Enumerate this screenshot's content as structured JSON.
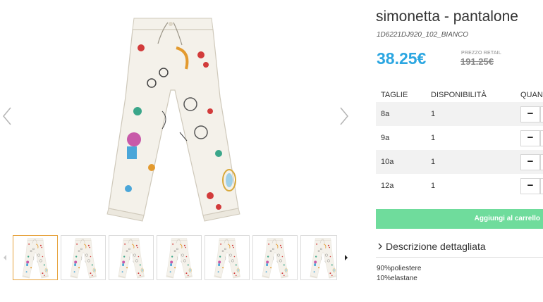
{
  "product": {
    "title": "simonetta - pantalone",
    "sku": "1D6221DJ920_102_BIANCO",
    "price": "38.25€",
    "retail_label": "PREZZO RETAIL",
    "retail_price": "191.25€"
  },
  "sizes_table": {
    "headers": [
      "TAGLIE",
      "DISPONIBILITÀ",
      "QUAN"
    ],
    "rows": [
      {
        "size": "8a",
        "availability": "1",
        "minus": "−"
      },
      {
        "size": "9a",
        "availability": "1",
        "minus": "−"
      },
      {
        "size": "10a",
        "availability": "1",
        "minus": "−"
      },
      {
        "size": "12a",
        "availability": "1",
        "minus": "−"
      }
    ]
  },
  "cart_button": "Aggiungi al carrello",
  "description": {
    "heading": "Descrizione dettagliata",
    "lines": [
      "90%poliestere",
      "10%elastane"
    ]
  },
  "colors": {
    "price": "#2ba6e1",
    "cart_button": "#6fdc9c",
    "active_thumb_border": "#e6a23c"
  },
  "icons": [
    "chevron-left-icon",
    "chevron-right-icon",
    "thumb-prev-icon",
    "thumb-next-icon",
    "chevron-right-small-icon"
  ]
}
